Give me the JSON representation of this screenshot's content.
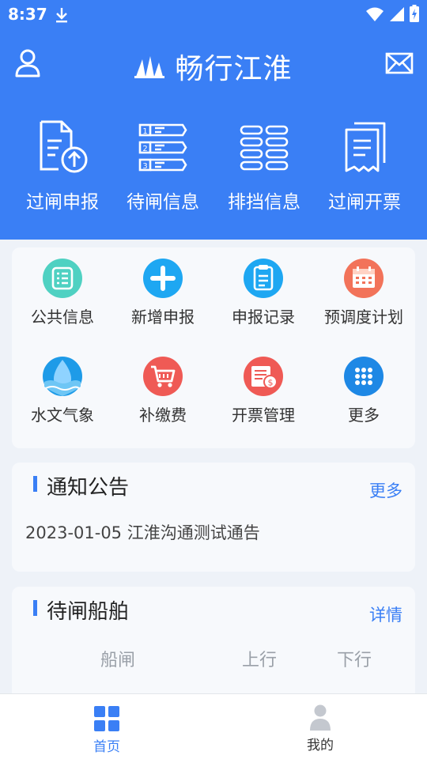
{
  "status_bar": {
    "time": "8:37"
  },
  "header": {
    "title": "畅行江淮"
  },
  "quick_actions": [
    {
      "label": "过闸申报",
      "icon": "document-upload-icon"
    },
    {
      "label": "待闸信息",
      "icon": "numbered-list-icon"
    },
    {
      "label": "排挡信息",
      "icon": "grid-slots-icon"
    },
    {
      "label": "过闸开票",
      "icon": "receipt-icon"
    }
  ],
  "grid_items": [
    {
      "label": "公共信息",
      "icon": "list-icon",
      "color": "#4fd1c2"
    },
    {
      "label": "新增申报",
      "icon": "plus-icon",
      "color": "#1ea7f2"
    },
    {
      "label": "申报记录",
      "icon": "clipboard-icon",
      "color": "#1ea7f2"
    },
    {
      "label": "预调度计划",
      "icon": "calendar-icon",
      "color": "#f2735a"
    },
    {
      "label": "水文气象",
      "icon": "water-drop-icon",
      "color": "#1e9be8"
    },
    {
      "label": "补缴费",
      "icon": "shopping-cart-icon",
      "color": "#ef5a55"
    },
    {
      "label": "开票管理",
      "icon": "invoice-icon",
      "color": "#ef5a55"
    },
    {
      "label": "更多",
      "icon": "more-grid-icon",
      "color": "#1e88e5"
    }
  ],
  "notice": {
    "title": "通知公告",
    "more": "更多",
    "items": [
      "2023-01-05 江淮沟通测试通告"
    ]
  },
  "ships": {
    "title": "待闸船舶",
    "more": "详情",
    "columns": [
      "船闸",
      "上行",
      "下行"
    ]
  },
  "bottom_nav": [
    {
      "label": "首页",
      "active": true
    },
    {
      "label": "我的",
      "active": false
    }
  ],
  "colors": {
    "primary": "#3a7ff5",
    "background": "#eef2f8"
  }
}
